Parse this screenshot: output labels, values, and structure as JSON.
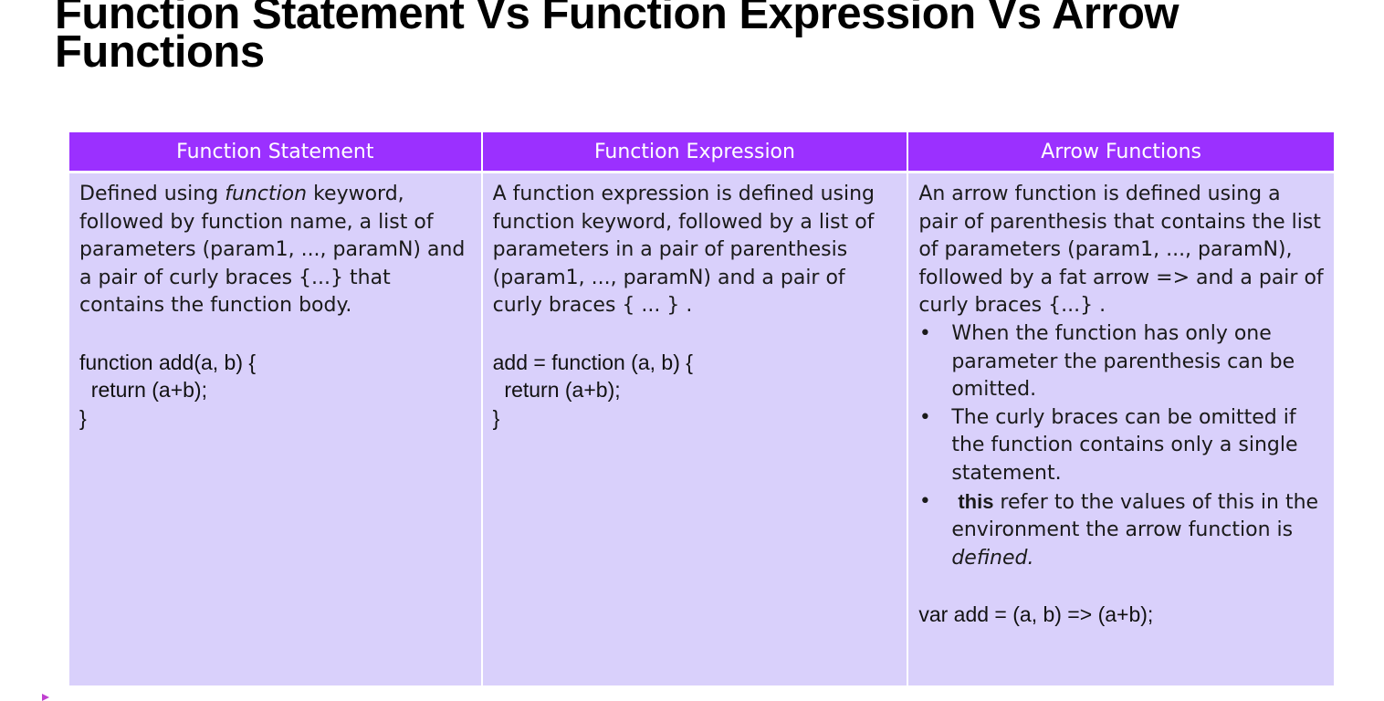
{
  "title": "Function Statement Vs Function Expression Vs Arrow Functions",
  "headers": [
    "Function Statement",
    "Function Expression",
    "Arrow Functions"
  ],
  "statement": {
    "desc_before": "Defined using ",
    "desc_keyword": "function",
    "desc_after": " keyword, followed by function name, a list of parameters (param1, ..., paramN) and a pair of curly braces {...} that contains the function body.",
    "code": "function add(a, b) {\n  return (a+b);\n}"
  },
  "expression": {
    "desc": "A function expression is defined using  function keyword, followed by a list of parameters in a pair of parenthesis (param1, ..., paramN) and a pair of curly braces { ... } .",
    "code": "add = function (a, b) {\n  return (a+b);\n}"
  },
  "arrow": {
    "desc": "An arrow function is defined using a pair of parenthesis that contains the list of parameters (param1, ..., paramN), followed by a fat arrow => and a pair of curly braces {...} .",
    "bullet_1": "When the function has only one parameter the parenthesis can be omitted.",
    "bullet_2": "The curly braces can be omitted if the function contains only a single statement.",
    "bullet_3_keyword": "this",
    "bullet_3_middle": "  refer to the values of this in the environment the arrow function is ",
    "bullet_3_emphasis": "defined.",
    "code": "var add = (a, b) => (a+b);"
  },
  "bullet_glyph": "•"
}
